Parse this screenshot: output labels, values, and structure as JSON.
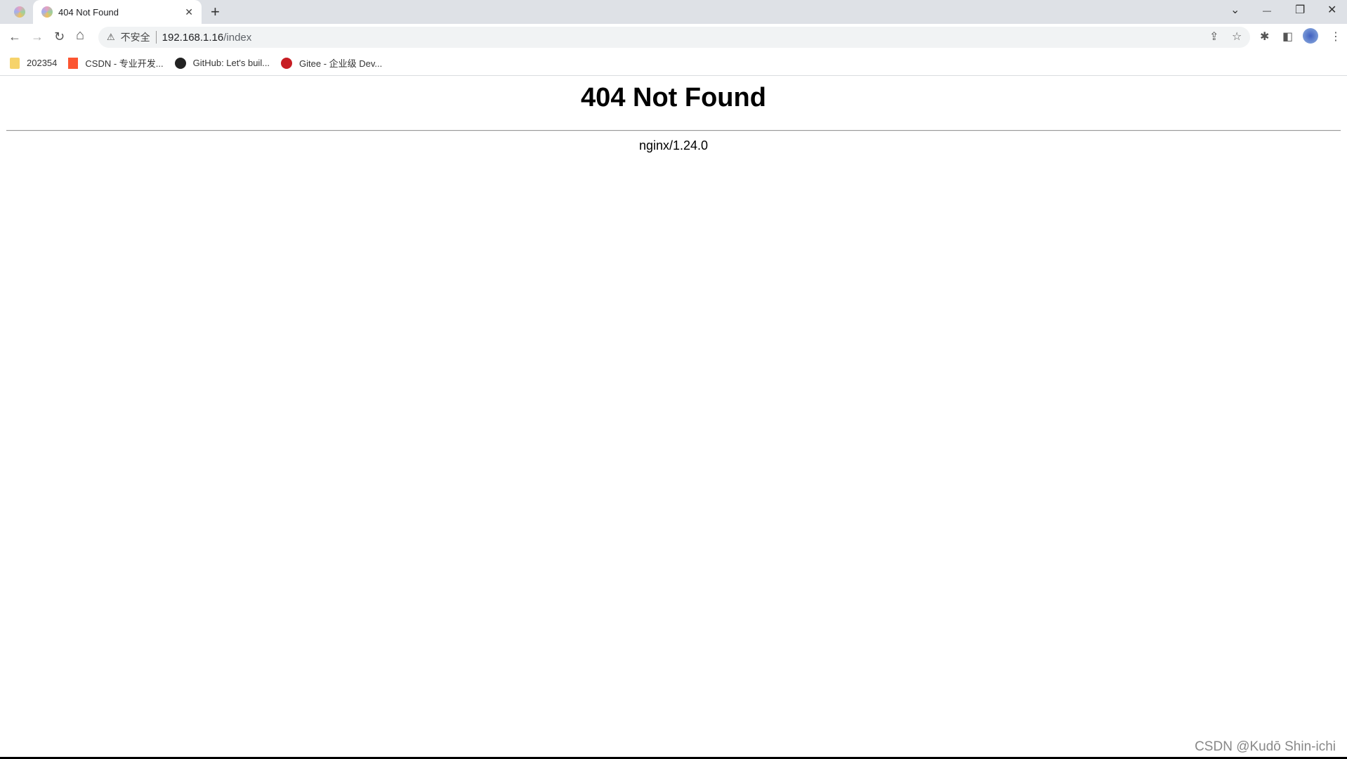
{
  "browser": {
    "tab": {
      "title": "404 Not Found",
      "close": "✕"
    },
    "new_tab": "+",
    "window": {
      "tab_search": "⌄",
      "minimize": "—",
      "restore": "❐",
      "close": "✕"
    },
    "nav": {
      "back": "←",
      "forward": "→",
      "reload": "↻",
      "home": "⌂"
    },
    "address": {
      "security_icon": "⚠",
      "security_label": "不安全",
      "host": "192.168.1.16",
      "path": "/index"
    },
    "toolbar_icons": {
      "share": "⇪",
      "bookmark": "☆",
      "extensions": "✱",
      "side_panel": "◧",
      "menu": "⋮"
    },
    "bookmarks": [
      {
        "label": "202354",
        "icon": "folder-icon",
        "color": "#f6d36b"
      },
      {
        "label": "CSDN - 专业开发...",
        "icon": "csdn-icon",
        "color": "#fc5531"
      },
      {
        "label": "GitHub: Let's buil...",
        "icon": "github-icon",
        "color": "#222222"
      },
      {
        "label": "Gitee - 企业级 Dev...",
        "icon": "gitee-icon",
        "color": "#c71d23"
      }
    ]
  },
  "page": {
    "heading": "404 Not Found",
    "server": "nginx/1.24.0"
  },
  "watermark": "CSDN @Kudō Shin-ichi"
}
